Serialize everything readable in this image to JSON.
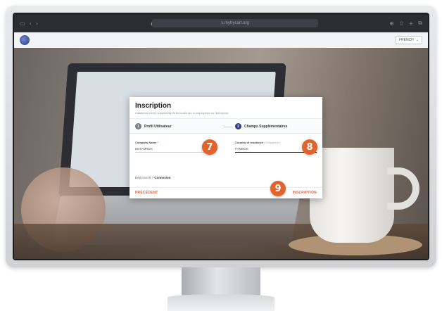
{
  "browser": {
    "url": "s.mytrycart.org",
    "left_icons": [
      "sidebar-icon",
      "back-icon",
      "forward-icon"
    ],
    "right_icons": [
      "download-icon",
      "share-icon",
      "new-tab-icon",
      "tabs-icon"
    ]
  },
  "app": {
    "language_label": "FRENCH",
    "language_chevron": "⌄"
  },
  "modal": {
    "title": "Inscription",
    "subtitle": "Ciasteprus nemo supplmenty lis fin tourlin ulu ui employeure so l'entreprise.",
    "steps": [
      {
        "number": "1",
        "label": "Profil Utilisateur",
        "color": "#7d8187"
      },
      {
        "number": "2",
        "label": "Champs Supplémentaires",
        "color": "#2b3f8a"
      }
    ],
    "fields": {
      "company": {
        "label": "Company Name",
        "required_mark": "*",
        "value": "DETAMRDS"
      },
      "country": {
        "label": "Country of residence",
        "optional": "(Obligatoire)",
        "value": "FAMBOS"
      }
    },
    "login_prompt": "Déjà inscrit ?",
    "login_link": "Connexion",
    "footer": {
      "previous": "PRÉCÉDENT",
      "submit": "INSCRIPTION"
    }
  },
  "callouts": [
    "7",
    "8",
    "9"
  ],
  "colors": {
    "accent": "#e0642c",
    "link": "#e0643f",
    "step_active": "#2b3f8a"
  }
}
